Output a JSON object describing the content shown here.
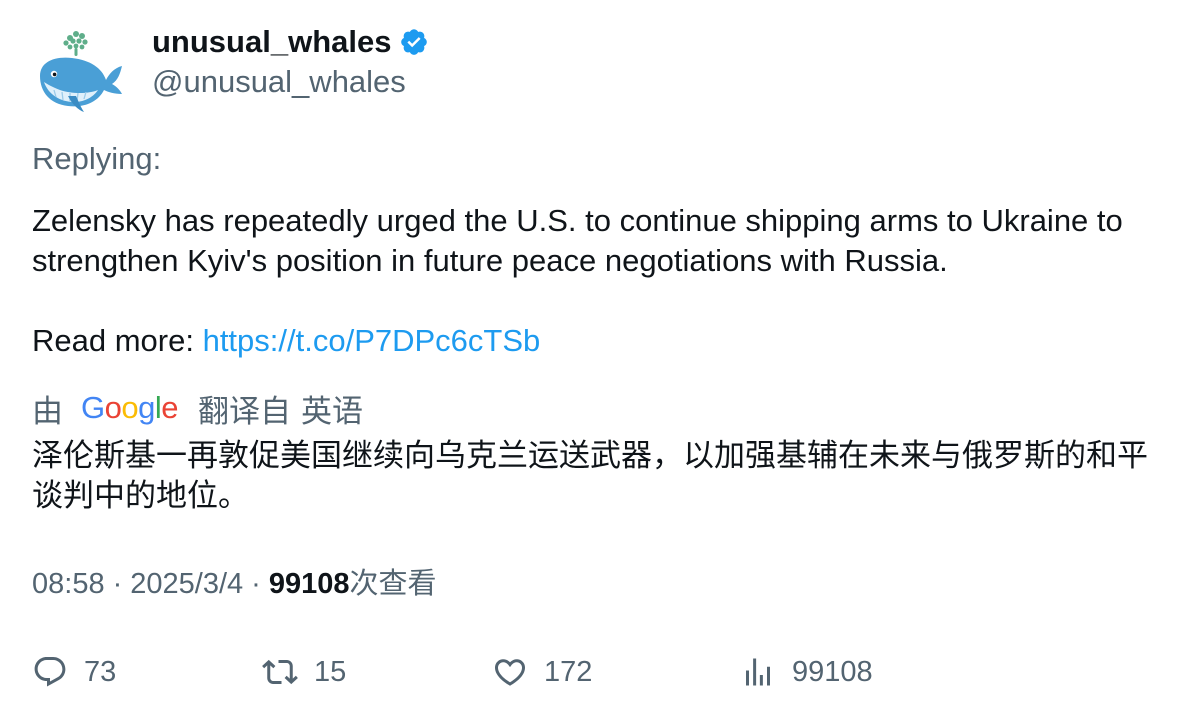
{
  "author": {
    "name": "unusual_whales",
    "handle": "@unusual_whales",
    "verified": true,
    "avatar_icon": "whale-logo-icon"
  },
  "tweet": {
    "replying_label": "Replying:",
    "text_line1": "Zelensky has repeatedly urged the U.S. to continue shipping arms to Ukraine to strengthen Kyiv's position in future peace negotiations with Russia.",
    "read_more_label": "Read more: ",
    "link_text": "https://t.co/P7DPc6cTSb"
  },
  "translation": {
    "by_label": "由",
    "provider": "Google",
    "from_label": "翻译自",
    "language": "英语",
    "text": "泽伦斯基一再敦促美国继续向乌克兰运送武器，以加强基辅在未来与俄罗斯的和平谈判中的地位。"
  },
  "meta": {
    "time": "08:58",
    "separator": "·",
    "date": "2025/3/4",
    "views_count": "99108",
    "views_label": "次查看"
  },
  "actions": {
    "replies": "73",
    "retweets": "15",
    "likes": "172",
    "views": "99108"
  },
  "colors": {
    "text_primary": "#0f1419",
    "text_secondary": "#536471",
    "link": "#1d9bf0",
    "verified": "#1d9bf0"
  }
}
